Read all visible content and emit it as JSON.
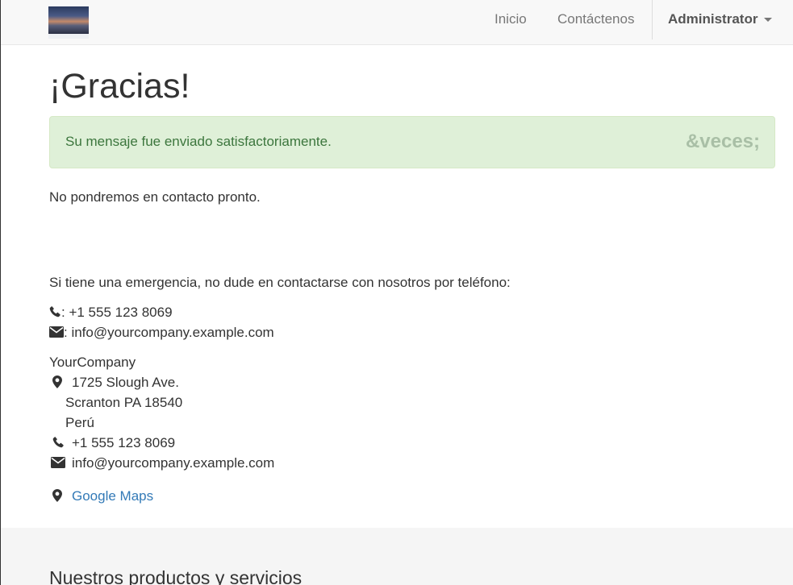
{
  "nav": {
    "items": [
      "Inicio",
      "Contáctenos"
    ],
    "user": "Administrator"
  },
  "page": {
    "title": "¡Gracias!",
    "alert_message": "Su mensaje fue enviado satisfactoriamente.",
    "alert_close": "&veces;",
    "followup": "No pondremos en contacto pronto.",
    "emergency": "Si tiene una emergencia, no dude en contactarse con nosotros por teléfono:",
    "phone_line": ": +1 555 123 8069",
    "email_line": ": info@yourcompany.example.com"
  },
  "company": {
    "name": "YourCompany",
    "street": "1725 Slough Ave.",
    "city": "Scranton PA 18540",
    "country": "Perú",
    "phone": "+1 555 123 8069",
    "email": "info@yourcompany.example.com",
    "maps_link": "Google Maps"
  },
  "footer": {
    "title": "Nuestros productos y servicios"
  },
  "colors": {
    "alert_bg": "#dff0d8",
    "alert_text": "#3c763d",
    "link": "#337ab7",
    "navbar_bg": "#f8f8f8"
  },
  "icons": [
    "phone-icon",
    "envelope-icon",
    "map-marker-icon"
  ]
}
